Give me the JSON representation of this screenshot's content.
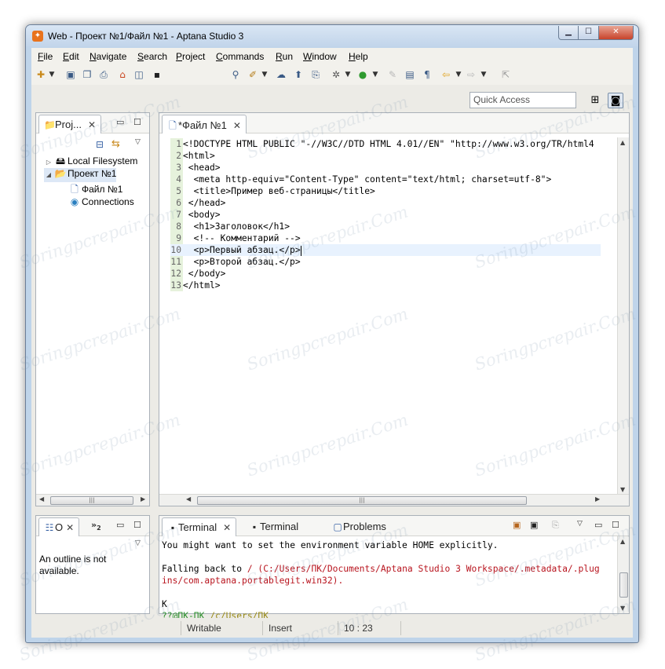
{
  "window": {
    "title": "Web - Проект №1/Файл №1 - Aptana Studio 3"
  },
  "menu": [
    "File",
    "Edit",
    "Navigate",
    "Search",
    "Project",
    "Commands",
    "Run",
    "Window",
    "Help"
  ],
  "quick_access": {
    "placeholder": "Quick Access"
  },
  "project_view": {
    "tab_label": "Proj...",
    "tree": {
      "local_filesystem": "Local Filesystem",
      "project": "Проект №1",
      "file": "Файл №1",
      "connections": "Connections"
    }
  },
  "editor": {
    "tab_label": "*Файл №1",
    "lines": [
      {
        "n": "1",
        "text": "<!DOCTYPE HTML PUBLIC \"-//W3C//DTD HTML 4.01//EN\" \"http://www.w3.org/TR/html4"
      },
      {
        "n": "2",
        "text": "<html>"
      },
      {
        "n": "3",
        "text": " <head>"
      },
      {
        "n": "4",
        "text": "  <meta http-equiv=\"Content-Type\" content=\"text/html; charset=utf-8\">"
      },
      {
        "n": "5",
        "text": "  <title>Пример веб-страницы</title>"
      },
      {
        "n": "6",
        "text": " </head>"
      },
      {
        "n": "7",
        "text": " <body>"
      },
      {
        "n": "8",
        "text": "  <h1>Заголовок</h1>"
      },
      {
        "n": "9",
        "text": "  <!-- Комментарий -->"
      },
      {
        "n": "10",
        "text": "  <p>Первый абзац.</p>"
      },
      {
        "n": "11",
        "text": "  <p>Второй абзац.</p>"
      },
      {
        "n": "12",
        "text": " </body>"
      },
      {
        "n": "13",
        "text": "</html>"
      }
    ],
    "current_line": "10"
  },
  "outline_view": {
    "tab_label": "O",
    "overflow_label": "»",
    "overflow_count": "2",
    "message": "An outline is not available."
  },
  "bottom_tabs": [
    "Terminal",
    "Terminal",
    "Problems"
  ],
  "console": {
    "line1": "You might want to set the environment variable HOME explicitly.",
    "line2_prefix": "Falling back to ",
    "line2_path": "/ (C:/Users/ПК/Documents/Aptana Studio 3 Workspace/.metadata/.plug",
    "line3_path": "ins/com.aptana.portablegit.win32).",
    "line4": "K",
    "prompt_user": "??@ПК-ПК",
    "prompt_path": " /c/Users/ПК",
    "prompt_symbol": "$"
  },
  "status": {
    "writable": "Writable",
    "insert": "Insert",
    "position": "10 : 23"
  },
  "watermark": "Soringpcrepair.Com",
  "icons": [
    "new-icon",
    "save-icon",
    "save-all-icon",
    "print-icon",
    "home-icon",
    "terminal-icon",
    "debug-icon",
    "run-icon",
    "back-icon",
    "forward-icon",
    "open-perspective-icon",
    "web-perspective-icon",
    "folder-icon",
    "file-icon",
    "connections-icon",
    "outline-icon"
  ]
}
